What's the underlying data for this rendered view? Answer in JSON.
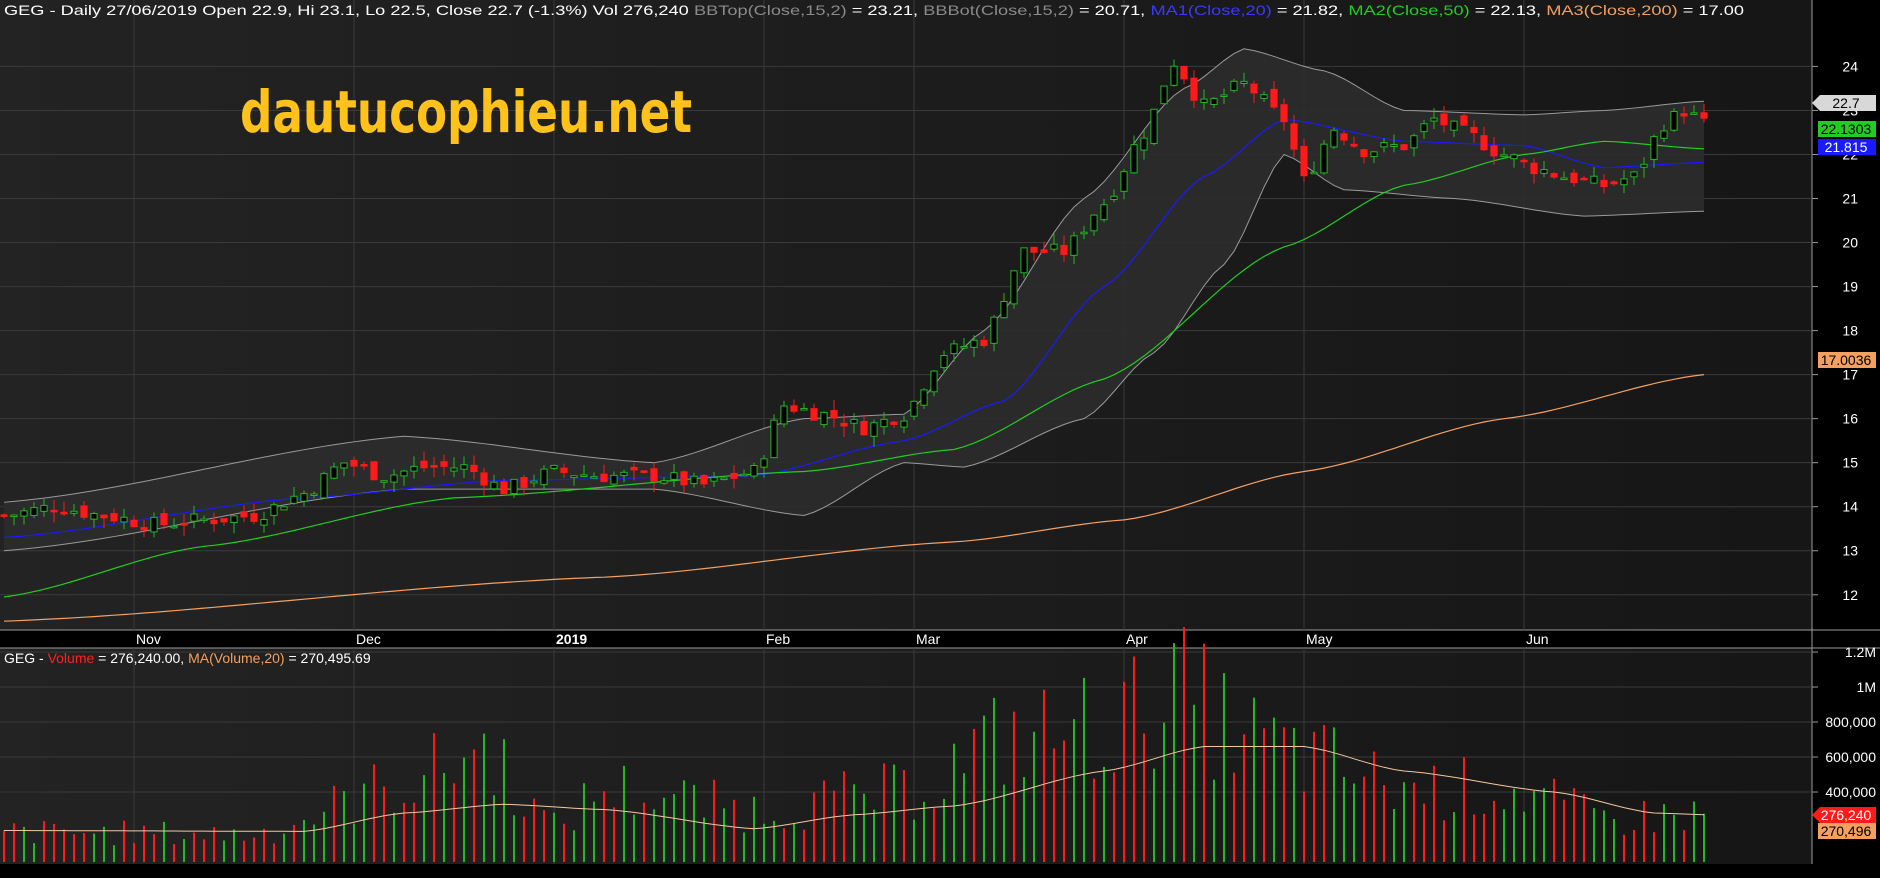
{
  "header": {
    "symbol": "GEG",
    "prefix": " - Daily 27/06/2019 Open 22.9, Hi 23.1, Lo 22.5, Close 22.7 (-1.3%) Vol 276,240",
    "bbtop_label": "BBTop(Close,15,2)",
    "bbtop_value": " = 23.21,",
    "bbbot_label": "BBBot(Close,15,2)",
    "bbbot_value": " = 20.71,",
    "ma1_label": "MA1(Close,20)",
    "ma1_value": " = 21.82,",
    "ma2_label": "MA2(Close,50)",
    "ma2_value": " = 22.13,",
    "ma3_label": "MA3(Close,200)",
    "ma3_value": " = 17.00"
  },
  "volume_header": {
    "symbol": "GEG",
    "dash": " - ",
    "volume_label": "Volume",
    "volume_value": " = 276,240.00, ",
    "ma_label": "MA(Volume,20)",
    "ma_value": " = 270,495.69"
  },
  "watermark": "dautucophieu.net",
  "last_value_tags": {
    "close": "22.7",
    "ma2": "22.1303",
    "ma1": "21.815",
    "ma3": "17.0036",
    "volume": "276,240",
    "volume_ma": "270,496"
  },
  "colors": {
    "background": "#000000",
    "up": "#22b822",
    "down": "#ff1a1a",
    "ma1": "#1a1aff",
    "ma2": "#22cc22",
    "ma3": "#f5a060",
    "bands": "#9a9a9a",
    "watermark": "#ffc21a"
  },
  "chart_data": [
    {
      "type": "candlestick",
      "title": "GEG - Daily 27/06/2019",
      "ylim": [
        11.2,
        24.6
      ],
      "y_ticks": [
        12,
        13,
        14,
        15,
        16,
        17,
        18,
        19,
        20,
        21,
        22,
        23,
        24
      ],
      "x_month_labels": [
        "Nov",
        "Dec",
        "2019",
        "Feb",
        "Mar",
        "Apr",
        "May",
        "Jun"
      ],
      "x_month_bar_index": [
        13,
        35,
        55,
        76,
        91,
        112,
        130,
        152
      ],
      "grid": true,
      "series": [
        {
          "name": "BBTop(Close,15,2)",
          "keypoints": [
            [
              0,
              14.1
            ],
            [
              40,
              15.6
            ],
            [
              65,
              15.0
            ],
            [
              80,
              16.0
            ],
            [
              90,
              16.1
            ],
            [
              98,
              18.0
            ],
            [
              108,
              21.0
            ],
            [
              118,
              23.5
            ],
            [
              124,
              24.4
            ],
            [
              132,
              23.9
            ],
            [
              140,
              23.0
            ],
            [
              152,
              22.9
            ],
            [
              160,
              23.0
            ],
            [
              170,
              23.21
            ]
          ]
        },
        {
          "name": "BBBot(Close,15,2)",
          "keypoints": [
            [
              0,
              13.0
            ],
            [
              40,
              14.4
            ],
            [
              65,
              14.4
            ],
            [
              80,
              13.8
            ],
            [
              90,
              15.0
            ],
            [
              96,
              14.9
            ],
            [
              108,
              16.0
            ],
            [
              115,
              17.5
            ],
            [
              122,
              19.5
            ],
            [
              128,
              22.0
            ],
            [
              134,
              21.2
            ],
            [
              145,
              21.0
            ],
            [
              158,
              20.6
            ],
            [
              170,
              20.71
            ]
          ]
        },
        {
          "name": "MA1(Close,20)",
          "keypoints": [
            [
              0,
              13.3
            ],
            [
              30,
              14.2
            ],
            [
              50,
              14.6
            ],
            [
              75,
              14.7
            ],
            [
              90,
              15.5
            ],
            [
              100,
              16.4
            ],
            [
              110,
              19.0
            ],
            [
              120,
              21.5
            ],
            [
              128,
              22.8
            ],
            [
              140,
              22.3
            ],
            [
              152,
              22.2
            ],
            [
              160,
              21.7
            ],
            [
              170,
              21.82
            ]
          ]
        },
        {
          "name": "MA2(Close,50)",
          "keypoints": [
            [
              0,
              11.95
            ],
            [
              20,
              13.1
            ],
            [
              45,
              14.2
            ],
            [
              80,
              14.8
            ],
            [
              95,
              15.3
            ],
            [
              110,
              16.9
            ],
            [
              128,
              19.9
            ],
            [
              140,
              21.3
            ],
            [
              152,
              22.0
            ],
            [
              160,
              22.3
            ],
            [
              170,
              22.13
            ]
          ]
        },
        {
          "name": "MA3(Close,200)",
          "keypoints": [
            [
              0,
              11.4
            ],
            [
              60,
              12.4
            ],
            [
              95,
              13.2
            ],
            [
              112,
              13.7
            ],
            [
              130,
              14.8
            ],
            [
              150,
              16.0
            ],
            [
              170,
              17.0
            ]
          ]
        }
      ],
      "close_keypoints": [
        [
          0,
          13.8
        ],
        [
          5,
          14.0
        ],
        [
          10,
          13.8
        ],
        [
          15,
          13.6
        ],
        [
          20,
          13.7
        ],
        [
          25,
          13.8
        ],
        [
          30,
          14.3
        ],
        [
          34,
          15.0
        ],
        [
          38,
          14.7
        ],
        [
          42,
          14.9
        ],
        [
          46,
          14.9
        ],
        [
          50,
          14.4
        ],
        [
          55,
          14.8
        ],
        [
          60,
          14.7
        ],
        [
          65,
          14.7
        ],
        [
          70,
          14.5
        ],
        [
          75,
          14.8
        ],
        [
          78,
          16.3
        ],
        [
          82,
          16.1
        ],
        [
          86,
          15.8
        ],
        [
          90,
          16.1
        ],
        [
          94,
          17.5
        ],
        [
          98,
          17.8
        ],
        [
          102,
          19.8
        ],
        [
          106,
          19.8
        ],
        [
          110,
          20.9
        ],
        [
          114,
          22.5
        ],
        [
          117,
          24.1
        ],
        [
          120,
          23.1
        ],
        [
          124,
          23.6
        ],
        [
          128,
          22.8
        ],
        [
          130,
          21.4
        ],
        [
          133,
          22.6
        ],
        [
          136,
          22.1
        ],
        [
          140,
          22.2
        ],
        [
          143,
          22.8
        ],
        [
          146,
          22.5
        ],
        [
          150,
          22.0
        ],
        [
          153,
          21.7
        ],
        [
          156,
          21.5
        ],
        [
          160,
          21.3
        ],
        [
          163,
          21.5
        ],
        [
          166,
          22.7
        ],
        [
          168,
          23.0
        ],
        [
          170,
          22.7
        ]
      ]
    },
    {
      "type": "bar",
      "title": "GEG - Volume",
      "ylim": [
        0,
        1250000
      ],
      "y_ticks": [
        400000,
        600000,
        800000,
        1000000,
        1200000
      ],
      "y_tick_labels": [
        "400,000",
        "600,000",
        "800,000",
        "1M",
        "1.2M"
      ],
      "grid": true,
      "series": [
        {
          "name": "Volume",
          "last": 276240
        },
        {
          "name": "MA(Volume,20)",
          "last": 270496,
          "keypoints": [
            [
              0,
              180000
            ],
            [
              30,
              175000
            ],
            [
              40,
              280000
            ],
            [
              50,
              330000
            ],
            [
              60,
              300000
            ],
            [
              75,
              190000
            ],
            [
              85,
              270000
            ],
            [
              95,
              320000
            ],
            [
              110,
              520000
            ],
            [
              120,
              660000
            ],
            [
              130,
              660000
            ],
            [
              140,
              520000
            ],
            [
              155,
              400000
            ],
            [
              165,
              280000
            ],
            [
              170,
              270496
            ]
          ]
        }
      ],
      "volume_keypoints": [
        [
          0,
          170000
        ],
        [
          25,
          160000
        ],
        [
          40,
          450000
        ],
        [
          48,
          650000
        ],
        [
          55,
          200000
        ],
        [
          60,
          420000
        ],
        [
          75,
          300000
        ],
        [
          90,
          400000
        ],
        [
          100,
          700000
        ],
        [
          112,
          800000
        ],
        [
          116,
          1000000
        ],
        [
          125,
          700000
        ],
        [
          130,
          600000
        ],
        [
          140,
          420000
        ],
        [
          150,
          420000
        ],
        [
          160,
          250000
        ],
        [
          170,
          276240
        ]
      ]
    }
  ]
}
